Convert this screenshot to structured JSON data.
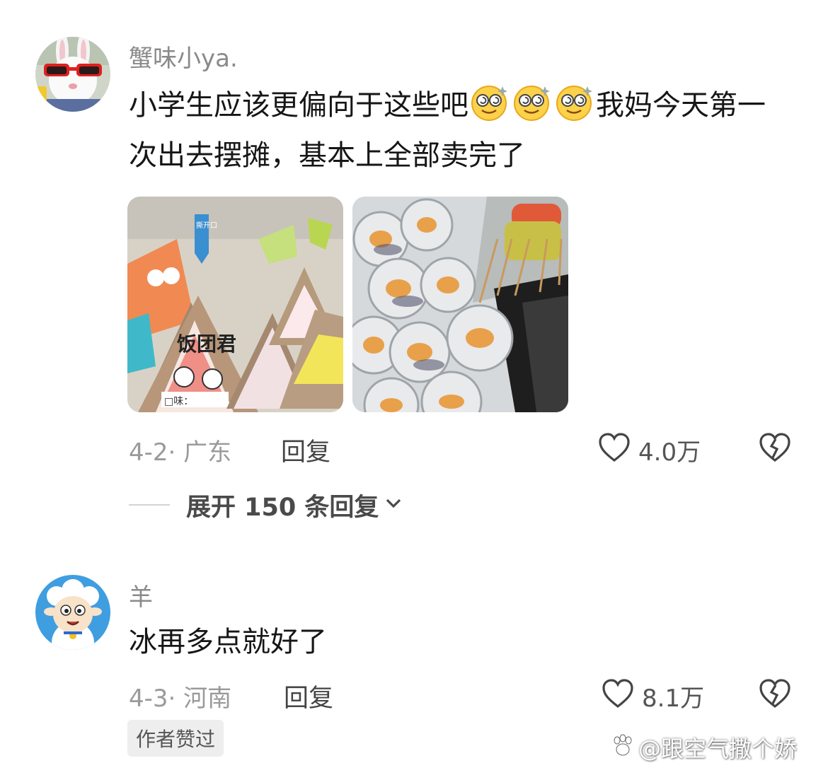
{
  "comments": [
    {
      "username": "蟹味小ya.",
      "text_part1": "小学生应该更偏向于这些吧",
      "emoji_count": 3,
      "emoji_name": "dizzy-smile-emoji",
      "text_part2": "我妈今天第一次出去摆摊，基本上全部卖完了",
      "images": [
        {
          "labels": {
            "tag_top": "撕开口",
            "brand": "饭团君",
            "flavor": "□味："
          }
        },
        {
          "labels": {}
        }
      ],
      "date_location": "4-2· 广东",
      "reply_label": "回复",
      "likes": "4.0万",
      "expand_replies": "展开 150 条回复"
    },
    {
      "username": "羊",
      "text": "冰再多点就好了",
      "date_location": "4-3· 河南",
      "reply_label": "回复",
      "likes": "8.1万",
      "author_badge": "作者赞过"
    }
  ],
  "watermark": "@跟空气撒个娇",
  "colors": {
    "heart_icon": "#444444",
    "meta_gray": "#9a9a9a",
    "badge_bg": "#eeeeee"
  },
  "icons": [
    "heart-icon",
    "broken-heart-icon",
    "chevron-down-icon",
    "paw-icon"
  ]
}
